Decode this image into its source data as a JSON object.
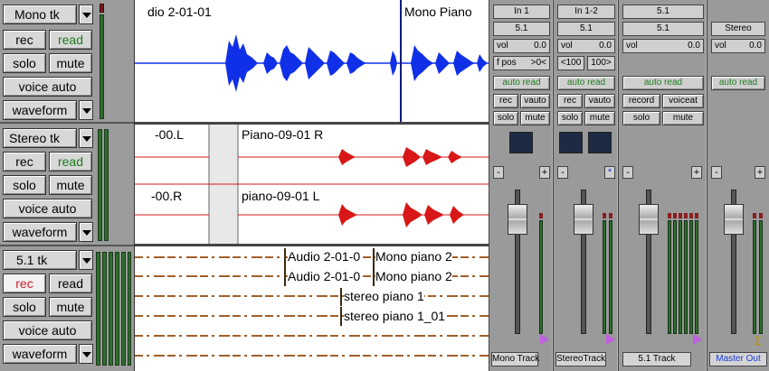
{
  "tracks": [
    {
      "name": "Mono tk",
      "rec": "rec",
      "read": "read",
      "solo": "solo",
      "mute": "mute",
      "voice": "voice auto",
      "view": "waveform"
    },
    {
      "name": "Stereo tk",
      "rec": "rec",
      "read": "read",
      "solo": "solo",
      "mute": "mute",
      "voice": "voice auto",
      "view": "waveform"
    },
    {
      "name": "5.1 tk",
      "rec": "rec",
      "read": "read",
      "solo": "solo",
      "mute": "mute",
      "voice": "voice auto",
      "view": "waveform"
    }
  ],
  "clips": {
    "mono_a": "dio 2-01-01",
    "mono_b": "Mono Piano",
    "stereo_l_a": "-00.L",
    "stereo_l_b": "Piano-09-01 R",
    "stereo_r_a": "-00.R",
    "stereo_r_b": "piano-09-01 L",
    "surround": [
      "Audio 2-01-0",
      "Mono piano 2",
      "Audio 2-01-0",
      "Mono piano 2",
      "stereo piano 1",
      "stereo piano 1_01"
    ]
  },
  "mixer": {
    "strips": [
      {
        "input": "In 1",
        "output": "5.1",
        "vol_label": "vol",
        "vol_value": "0.0",
        "pan_label": "f pos",
        "pan_value": ">0<",
        "auto": "auto read",
        "b1": "rec",
        "b2": "vauto",
        "b3": "solo",
        "b4": "mute",
        "name": "Mono Track"
      },
      {
        "input": "In 1-2",
        "output": "5.1",
        "vol_label": "vol",
        "vol_value": "0.0",
        "pan_l": "<100",
        "pan_r": "100>",
        "auto": "auto read",
        "b1": "rec",
        "b2": "vauto",
        "b3": "solo",
        "b4": "mute",
        "name": "StereoTrack"
      },
      {
        "input": "5.1",
        "output": "5.1",
        "vol_label": "vol",
        "vol_value": "0.0",
        "auto": "auto read",
        "b1": "record",
        "b2": "voiceat",
        "b3": "solo",
        "b4": "mute",
        "name": "5.1 Track"
      },
      {
        "output": "Stereo",
        "vol_label": "vol",
        "vol_value": "0.0",
        "auto": "auto read",
        "name": "Master Out"
      }
    ],
    "minus": "-",
    "plus": "+"
  },
  "colors": {
    "waveform_mono": "#1030e8",
    "waveform_stereo": "#d81818",
    "waveform_surround": "#a0602a",
    "read_green": "#1d7a1d",
    "rec_red": "#d21a2a",
    "master_blue": "#1a3ad8"
  }
}
